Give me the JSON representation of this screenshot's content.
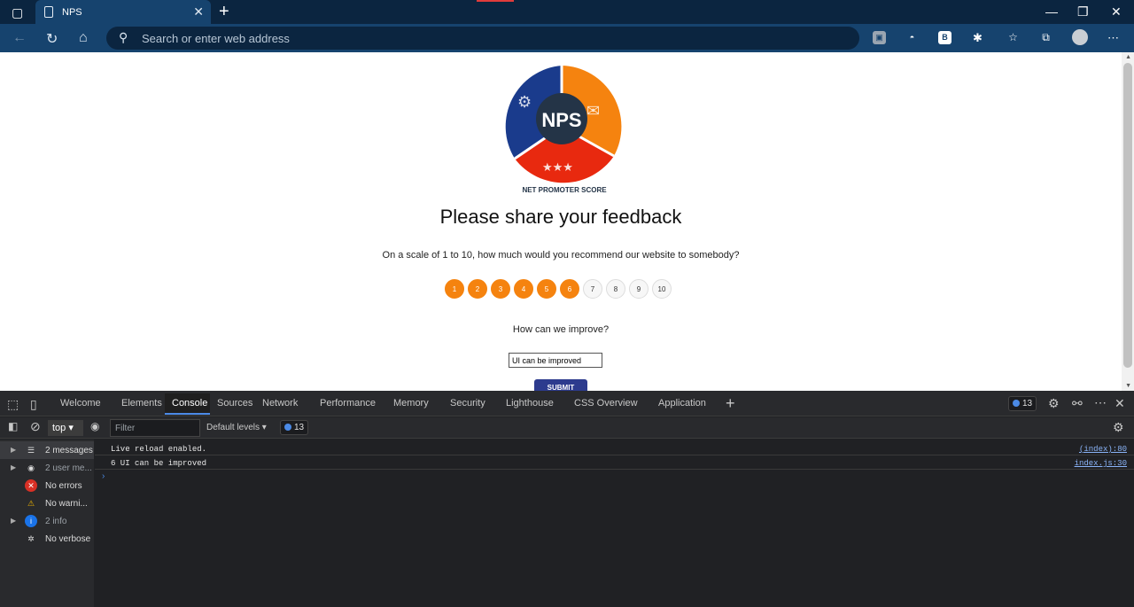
{
  "browser": {
    "tab_title": "NPS",
    "address_placeholder": "Search or enter web address"
  },
  "page": {
    "logo_text": "NPS",
    "logo_caption": "NET PROMOTER SCORE",
    "heading": "Please share your feedback",
    "question": "On a scale of 1 to 10, how much would you recommend our website to somebody?",
    "scores": [
      "1",
      "2",
      "3",
      "4",
      "5",
      "6",
      "7",
      "8",
      "9",
      "10"
    ],
    "selected_score": 6,
    "improve_label": "How can we improve?",
    "improve_value": "UI can be improved",
    "submit_label": "SUBMIT"
  },
  "devtools": {
    "tabs": [
      "Welcome",
      "Elements",
      "Console",
      "Sources",
      "Network",
      "Performance",
      "Memory",
      "Security",
      "Lighthouse",
      "CSS Overview",
      "Application"
    ],
    "active_tab": "Console",
    "issues_count": "13",
    "context": "top",
    "filter_placeholder": "Filter",
    "levels": "Default levels",
    "sidebar": [
      {
        "label": "2 messages",
        "icon": "list-icon"
      },
      {
        "label": "2 user me...",
        "icon": "user-icon"
      },
      {
        "label": "No errors",
        "icon": "error-icon"
      },
      {
        "label": "No warni...",
        "icon": "warning-icon"
      },
      {
        "label": "2 info",
        "icon": "info-icon"
      },
      {
        "label": "No verbose",
        "icon": "bug-icon"
      }
    ],
    "logs": [
      {
        "message": "Live reload enabled.",
        "source": "(index):80"
      },
      {
        "message": "6 UI can be improved",
        "source": "index.js:30"
      }
    ]
  },
  "colors": {
    "accent_orange": "#f5830f",
    "submit_blue": "#2d3b8e",
    "browser_blue": "#16436e"
  }
}
